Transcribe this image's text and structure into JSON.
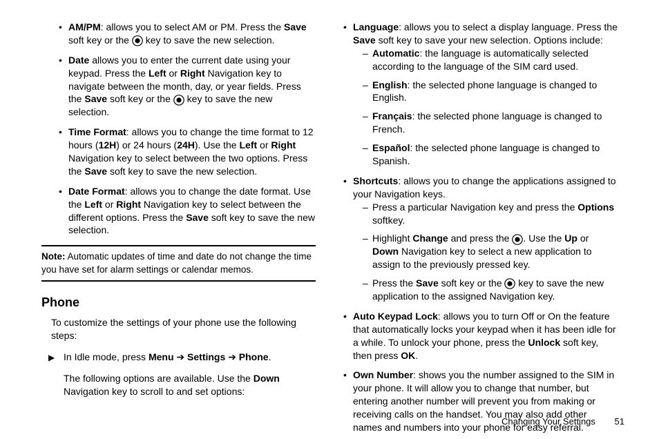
{
  "left": {
    "items": [
      {
        "label": "AM/PM",
        "t1": ": allows you to select AM or PM. Press the ",
        "b1": "Save",
        "t2": " soft key or the ",
        "icon": true,
        "t3": " key to save the new selection."
      },
      {
        "label": "Date",
        "t1": " allows you to enter the current date using your keypad. Press the ",
        "b1": "Left",
        "t2": " or ",
        "b2": "Right",
        "t3": " Navigation key to navigate between the month, day, or year fields. Press the ",
        "b3": "Save",
        "t4": " soft key or the ",
        "icon": true,
        "t5": " key to save the new selection."
      },
      {
        "label": "Time Format",
        "t1": ": allows you to change the time format to 12 hours (",
        "b1": "12H",
        "t2": ") or 24 hours (",
        "b2": "24H",
        "t3": "). Use the ",
        "b3": "Left",
        "t4": " or ",
        "b4": "Right",
        "t5": " Navigation key to select between the two options. Press the ",
        "b5": "Save",
        "t6": " soft key to save the new selection."
      },
      {
        "label": "Date Format",
        "t1": ": allows you to change the date format. Use the ",
        "b1": "Left",
        "t2": " or ",
        "b2": "Right",
        "t3": " Navigation key to select between the different options. Press the ",
        "b3": "Save",
        "t4": " soft key to save the new selection."
      }
    ],
    "note_label": "Note:",
    "note_text": " Automatic updates of time and date do not change the time you have set for alarm settings or calendar memos.",
    "phone_h": "Phone",
    "phone_intro": "To customize the settings of your phone use the following steps:",
    "step_t1": "In Idle mode, press ",
    "step_b1": "Menu",
    "step_t2": "  ➔ ",
    "step_b2": "Settings",
    "step_t3": " ➔ ",
    "step_b3": "Phone",
    "step_t4": ".",
    "step_cont1": "The following options are available. Use the ",
    "step_cont_b": "Down",
    "step_cont2": " Navigation key to scroll to and set options:"
  },
  "right": {
    "lang": {
      "label": "Language",
      "t1": ": allows you to select a display language. Press the ",
      "b1": "Save",
      "t2": " soft key to save your new selection. Options include:",
      "subs": [
        {
          "b": "Automatic",
          "t": ": the language is automatically selected according to the language of the SIM card used."
        },
        {
          "b": "English",
          "t": ": the selected phone language is changed to English."
        },
        {
          "b": "Français",
          "t": ": the selected phone language is changed to French."
        },
        {
          "b": "Español",
          "t": ": the selected phone language is changed to Spanish."
        }
      ]
    },
    "shortcuts": {
      "label": "Shortcuts",
      "t1": ": allows you to change the applications assigned to your Navigation keys.",
      "s1_t1": "Press a particular Navigation key and press the ",
      "s1_b1": "Options",
      "s1_t2": " softkey.",
      "s2_t1": "Highlight ",
      "s2_b1": "Change",
      "s2_t2": " and press the ",
      "s2_icon": true,
      "s2_t3": ". Use the ",
      "s2_b2": "Up",
      "s2_t4": " or ",
      "s2_b3": "Down",
      "s2_t5": " Navigation key to select a new application to assign to the previously pressed key.",
      "s3_t1": "Press the ",
      "s3_b1": "Save",
      "s3_t2": " soft key or the ",
      "s3_icon": true,
      "s3_t3": " key to save the new application to the assigned Navigation key."
    },
    "autokey": {
      "label": "Auto Keypad Lock",
      "t1": ": allows you to turn Off or On the feature that automatically locks your keypad when it has been idle for a while. To unlock your phone, press the ",
      "b1": "Unlock",
      "t2": " soft key, then press ",
      "b2": "OK",
      "t3": "."
    },
    "own": {
      "label": "Own Number",
      "t1": ": shows you the number assigned to the SIM in your phone. It will allow you to change that number, but entering another number will prevent you from making or receiving calls on the handset. You may also add other names and numbers into your phone for easy referral."
    }
  },
  "footer": {
    "section": "Changing Your Settings",
    "page": "51"
  }
}
